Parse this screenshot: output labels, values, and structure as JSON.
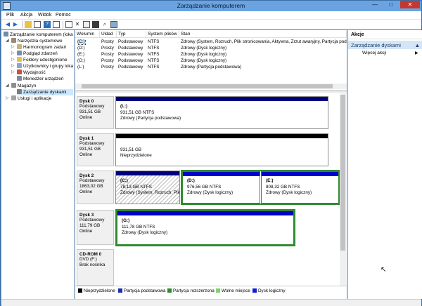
{
  "window": {
    "title": "Zarządzanie komputerem",
    "controls": {
      "minimize": "—",
      "maximize": "□",
      "close": "✕"
    }
  },
  "menu": [
    "Plik",
    "Akcja",
    "Widok",
    "Pomoc"
  ],
  "tree": {
    "root": "Zarządzanie komputerem (loka",
    "items": [
      {
        "label": "Narzędzia systemowe"
      },
      {
        "label": "Harmonogram zadań"
      },
      {
        "label": "Podgląd zdarzeń"
      },
      {
        "label": "Foldery udostępnione"
      },
      {
        "label": "Użytkownicy i grupy loka"
      },
      {
        "label": "Wydajność"
      },
      {
        "label": "Menedżer urządzeń"
      },
      {
        "label": "Magazyn"
      },
      {
        "label": "Zarządzanie dyskami"
      },
      {
        "label": "Usługi i aplikacje"
      }
    ]
  },
  "volumes": {
    "headers": [
      "Wolumin",
      "Układ",
      "Typ",
      "System plików",
      "Stan"
    ],
    "rows": [
      {
        "name": "(C:)",
        "layout": "Prosty",
        "type": "Podstawowy",
        "fs": "NTFS",
        "status": "Zdrowy (System, Rozruch, Plik stronicowania, Aktywna, Zrzut awaryjny, Partycja pod"
      },
      {
        "name": "(D:)",
        "layout": "Prosty",
        "type": "Podstawowy",
        "fs": "NTFS",
        "status": "Zdrowy (Dysk logiczny)"
      },
      {
        "name": "(E:)",
        "layout": "Prosty",
        "type": "Podstawowy",
        "fs": "NTFS",
        "status": "Zdrowy (Dysk logiczny)"
      },
      {
        "name": "(G:)",
        "layout": "Prosty",
        "type": "Podstawowy",
        "fs": "NTFS",
        "status": "Zdrowy (Dysk logiczny)"
      },
      {
        "name": "(L:)",
        "layout": "Prosty",
        "type": "Podstawowy",
        "fs": "NTFS",
        "status": "Zdrowy (Partycja podstawowa)"
      }
    ]
  },
  "disks": [
    {
      "name": "Dysk 0",
      "type": "Podstawowy",
      "size": "931,51 GB",
      "state": "Online",
      "partitions": [
        {
          "label": "(L:)",
          "size": "931,51 GB NTFS",
          "status": "Zdrowy (Partycja podstawowa)"
        }
      ]
    },
    {
      "name": "Dysk 1",
      "type": "Podstawowy",
      "size": "931,51 GB",
      "state": "Online",
      "partitions": [
        {
          "size": "931,51 GB",
          "status": "Nieprzydzielone"
        }
      ]
    },
    {
      "name": "Dysk 2",
      "type": "Podstawowy",
      "size": "1863,02 GB",
      "state": "Online",
      "partitions": [
        {
          "label": "(C:)",
          "size": "78,13 GB NTFS",
          "status": "Zdrowy (System, Rozruch, Plik"
        },
        {
          "label": "(D:)",
          "size": "976,56 GB NTFS",
          "status": "Zdrowy (Dysk logiczny)"
        },
        {
          "label": "(E:)",
          "size": "808,32 GB NTFS",
          "status": "Zdrowy (Dysk logiczny)"
        }
      ]
    },
    {
      "name": "Dysk 3",
      "type": "Podstawowy",
      "size": "111,79 GB",
      "state": "Online",
      "partitions": [
        {
          "label": "(G:)",
          "size": "111,78 GB NTFS",
          "status": "Zdrowy (Dysk logiczny)"
        }
      ]
    },
    {
      "name": "CD-ROM 0",
      "type": "DVD (F:)",
      "size": "",
      "state": "Brak nośnika",
      "partitions": []
    }
  ],
  "legend": [
    {
      "label": "Nieprzydzielone",
      "color": "#000000"
    },
    {
      "label": "Partycja podstawowa",
      "color": "#1a2fb0"
    },
    {
      "label": "Partycja rozszerzona",
      "color": "#2e8b2e"
    },
    {
      "label": "Wolne miejsce",
      "color": "#7cd46a"
    },
    {
      "label": "Dysk logiczny",
      "color": "#0b1fd6"
    }
  ],
  "actions": {
    "header": "Akcje",
    "section": "Zarządzanie dyskami",
    "more": "Więcej akcji"
  },
  "colors": {
    "primary_partition_bar": "#00007f",
    "unallocated_bar": "#000000",
    "logical_bar": "#0000c8",
    "extended_border": "#2e8b2e",
    "selection": "#cce8ff"
  }
}
